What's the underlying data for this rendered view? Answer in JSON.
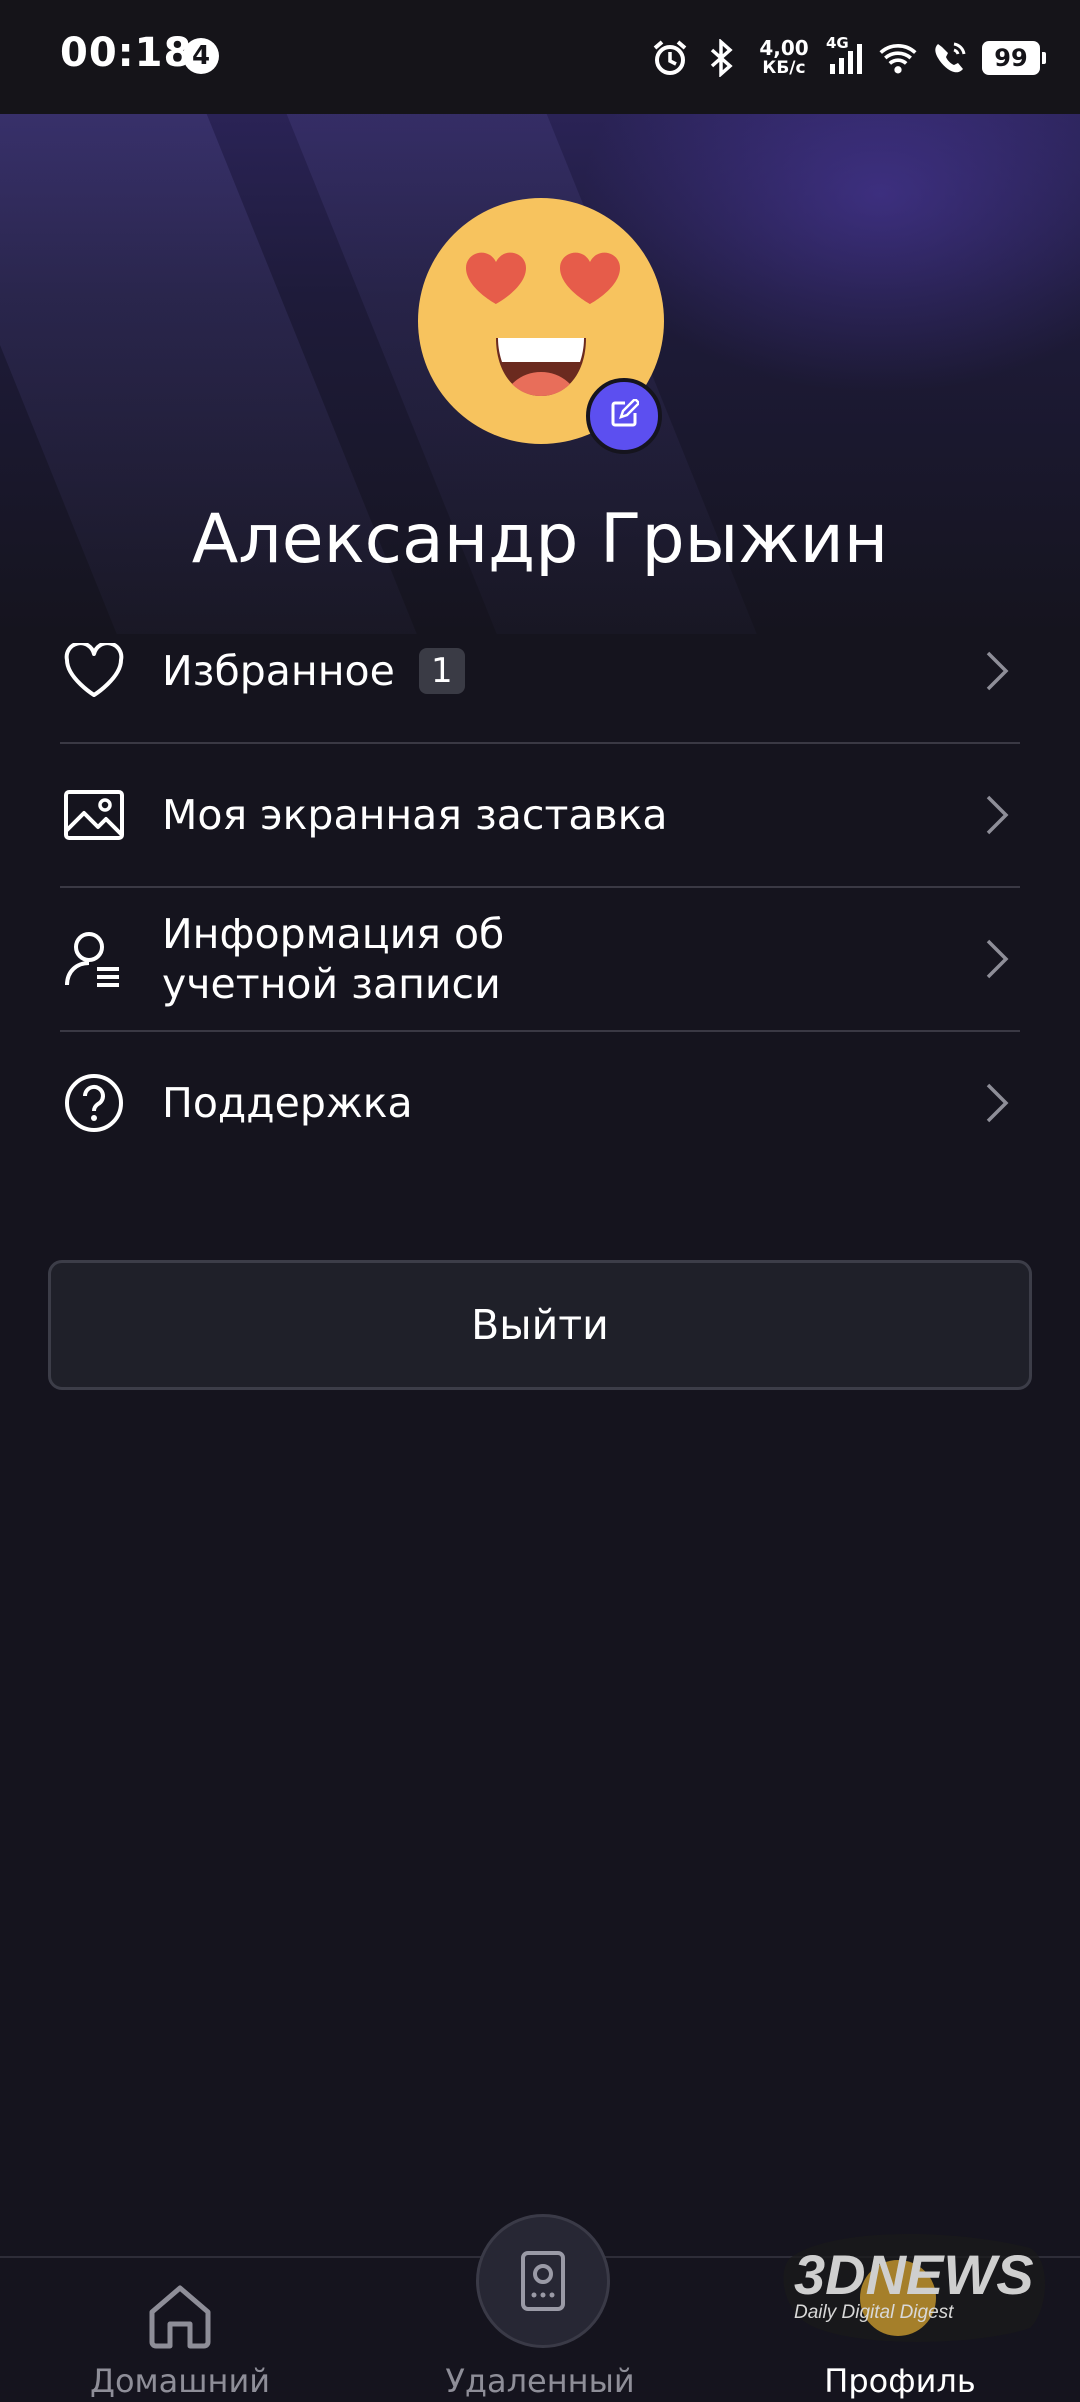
{
  "status_bar": {
    "time": "00:18",
    "notification_count": "4",
    "speed_value": "4,00",
    "speed_unit": "КБ/с",
    "network": "4G",
    "battery": "99",
    "icons": [
      "alarm-icon",
      "bluetooth-icon",
      "signal-icon",
      "wifi-icon",
      "wifi-call-icon",
      "battery-icon"
    ]
  },
  "profile": {
    "name": "Александр Грыжин",
    "avatar": "heart-eyes-emoji",
    "edit_icon": "edit-icon"
  },
  "menu": {
    "items": [
      {
        "label": "Избранное",
        "badge": "1",
        "icon": "heart-icon"
      },
      {
        "label": "Моя экранная заставка",
        "icon": "image-icon"
      },
      {
        "label": "Информация об",
        "label_line2": "учетной записи",
        "icon": "account-info-icon"
      },
      {
        "label": "Поддержка",
        "icon": "help-icon"
      }
    ]
  },
  "logout_label": "Выйти",
  "nav": {
    "home": "Домашний",
    "remote": "Удаленный",
    "profile": "Профиль",
    "active": "profile"
  },
  "watermark": {
    "brand": "3DNEWS",
    "tagline": "Daily Digital Digest"
  },
  "colors": {
    "background": "#15141e",
    "accent": "#5c4ff0",
    "divider": "#3a3944",
    "emoji_face": "#f7c35e",
    "emoji_heart": "#e65c4a"
  }
}
